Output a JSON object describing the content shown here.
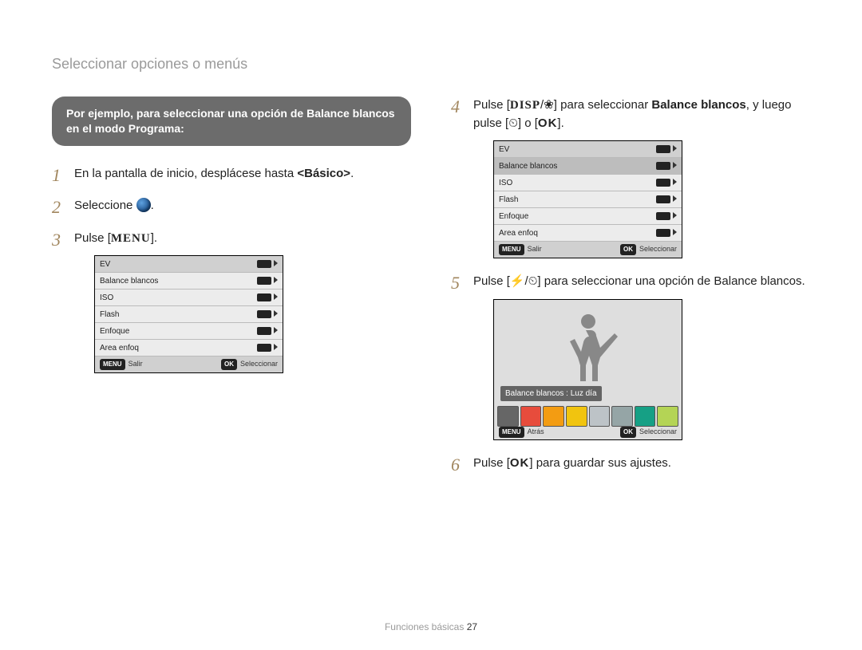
{
  "breadcrumb": "Seleccionar opciones o menús",
  "hint": "Por ejemplo, para seleccionar una opción de Balance blancos en el modo Programa:",
  "glyphs": {
    "menu": "MENU",
    "ok": "OK",
    "disp": "DISP",
    "flower": "❀",
    "flash": "⚡",
    "timer": "⏲"
  },
  "steps_left": [
    {
      "pre": "En la pantalla de inicio, desplácese hasta ",
      "bold": "<Básico>",
      "post": "."
    },
    {
      "pre": "Seleccione ",
      "icon": true,
      "post": "."
    },
    {
      "pre": "Pulse [",
      "glyph": "MENU",
      "post": "]."
    }
  ],
  "steps_right": [
    {
      "pre": "Pulse [",
      "glyphA": "DISP",
      "sep": "/",
      "glyphB": "❀",
      "mid": "] para seleccionar ",
      "bold": "Balance blancos",
      "tail_pre": ", y luego pulse [",
      "glyphC": "⏲",
      "tail_mid": "] o [",
      "glyphD": "OK",
      "tail_post": "]."
    },
    {
      "pre": "Pulse [",
      "glyphA": "⚡",
      "sep": "/",
      "glyphB": "⏲",
      "post": "] para seleccionar una opción de Balance blancos."
    },
    {
      "pre": "Pulse [",
      "glyphA": "OK",
      "post": "] para guardar sus ajustes."
    }
  ],
  "menu_screen": {
    "rows": [
      "EV",
      "Balance blancos",
      "ISO",
      "Flash",
      "Enfoque",
      "Area enfoq"
    ],
    "highlight_index": 1,
    "footer_left_badge": "MENU",
    "footer_left": "Salir",
    "footer_right_badge": "OK",
    "footer_right": "Seleccionar"
  },
  "wb_screen": {
    "overlay_label": "Balance blancos : Luz día",
    "swatches": [
      "#666666",
      "#e74c3c",
      "#f39c12",
      "#f1c40f",
      "#bdc3c7",
      "#95a5a6",
      "#16a085",
      "#b4d455"
    ],
    "footer_left_badge": "MENU",
    "footer_left": "Atrás",
    "footer_right_badge": "OK",
    "footer_right": "Seleccionar"
  },
  "footer": {
    "section": "Funciones básicas",
    "page": "27"
  }
}
